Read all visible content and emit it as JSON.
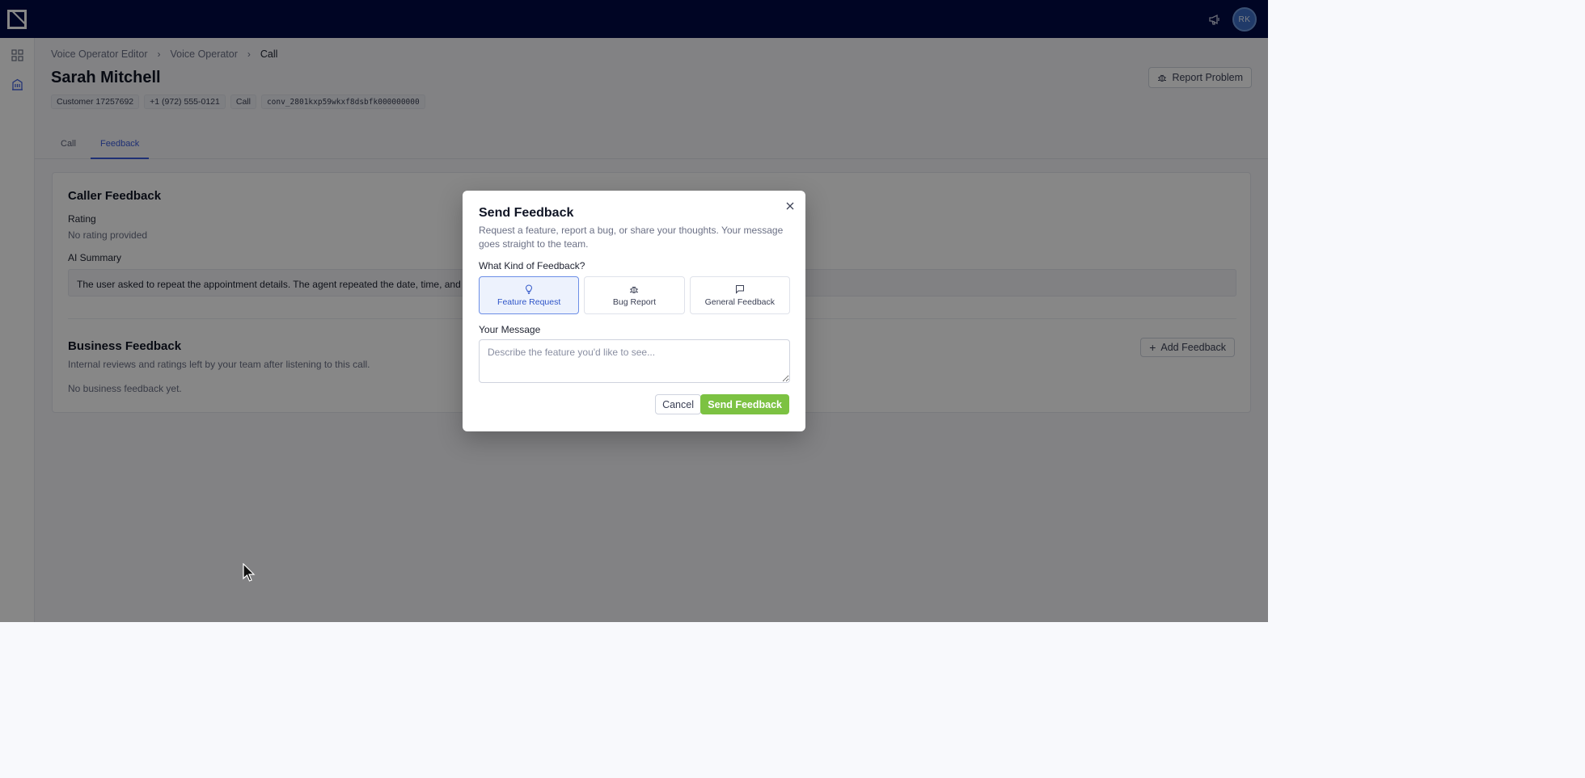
{
  "header": {
    "avatar_initials": "RK"
  },
  "breadcrumb": {
    "items": [
      "Voice Operator Editor",
      "Voice Operator"
    ],
    "current": "Call"
  },
  "page": {
    "title": "Sarah Mitchell",
    "chips": [
      "Customer 17257692",
      "+1 (972) 555-0121",
      "Call",
      "conv_2801kxp59wkxf8dsbfk000000000"
    ],
    "report_label": "Report Problem"
  },
  "tabs": [
    {
      "label": "Call",
      "active": false
    },
    {
      "label": "Feedback",
      "active": true
    }
  ],
  "caller_feedback": {
    "title": "Caller Feedback",
    "rating_label": "Rating",
    "rating_value": "No rating provided",
    "summary_label": "AI Summary",
    "summary_text": "The user asked to repeat the appointment details. The agent repeated the date, time, and"
  },
  "business_feedback": {
    "title": "Business Feedback",
    "description": "Internal reviews and ratings left by your team after listening to this call.",
    "empty": "No business feedback yet.",
    "add_label": "Add Feedback"
  },
  "dialog": {
    "title": "Send Feedback",
    "description": "Request a feature, report a bug, or share your thoughts. Your message goes straight to the team.",
    "kind_label": "What Kind of Feedback?",
    "options": [
      {
        "label": "Feature Request",
        "icon": "lightbulb-icon",
        "selected": true
      },
      {
        "label": "Bug Report",
        "icon": "bug-icon",
        "selected": false
      },
      {
        "label": "General Feedback",
        "icon": "message-icon",
        "selected": false
      }
    ],
    "message_label": "Your Message",
    "message_placeholder": "Describe the feature you'd like to see...",
    "cancel_label": "Cancel",
    "send_label": "Send Feedback"
  },
  "colors": {
    "topbar": "#000a44",
    "accent": "#3b5bdb",
    "send_button": "#7cc242",
    "selected_option_bg": "#edf2fd"
  }
}
